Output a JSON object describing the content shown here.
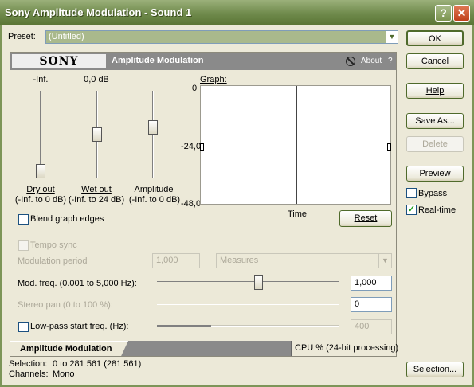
{
  "window": {
    "title": "Sony Amplitude Modulation - Sound 1",
    "help_glyph": "?",
    "close_glyph": "✕"
  },
  "preset": {
    "label": "Preset:",
    "value": "(Untitled)"
  },
  "buttons": {
    "ok": "OK",
    "cancel": "Cancel",
    "help": "Help",
    "save_as": "Save As...",
    "delete": "Delete",
    "preview": "Preview",
    "reset": "Reset",
    "selection": "Selection..."
  },
  "checkboxes": {
    "bypass": {
      "label": "Bypass",
      "checked": false
    },
    "real_time": {
      "label": "Real-time",
      "checked": true
    },
    "blend": {
      "label": "Blend graph edges",
      "checked": false
    },
    "tempo_sync": {
      "label": "Tempo sync",
      "checked": false
    },
    "lowpass": {
      "label": "Low-pass start freq. (Hz):",
      "checked": false
    }
  },
  "plugin": {
    "brand": "SONY",
    "title": "Amplitude Modulation",
    "about": "About",
    "help_q": "?"
  },
  "sliders": {
    "dry": {
      "top_value": "-Inf.",
      "label": "Dry out",
      "range": "(-Inf. to 0 dB)",
      "level": 0.0
    },
    "wet": {
      "top_value": "0,0 dB",
      "label": "Wet out",
      "range": "(-Inf. to 24 dB)",
      "level": 0.5
    },
    "amp": {
      "top_value": "",
      "label": "Amplitude",
      "range": "(-Inf. to 0 dB)",
      "level": 0.6
    }
  },
  "graph": {
    "label": "Graph:",
    "y_top": "0",
    "y_mid": "-24,0",
    "y_bottom": "-48,0",
    "x_label": "Time"
  },
  "modulation": {
    "period_label": "Modulation period",
    "period_value": "1,000",
    "period_unit": "Measures",
    "freq_label": "Mod. freq. (0.001 to 5,000 Hz):",
    "freq_value": "1,000",
    "pan_label": "Stereo pan (0 to 100 %):",
    "pan_value": "0",
    "lowpass_value": "400"
  },
  "tabs": {
    "active": "Amplitude Modulation",
    "cpu": "CPU % (24-bit processing)"
  },
  "status": {
    "selection_label": "Selection:",
    "selection_value": "0 to 281 561 (281 561)",
    "channels_label": "Channels:",
    "channels_value": "Mono"
  }
}
